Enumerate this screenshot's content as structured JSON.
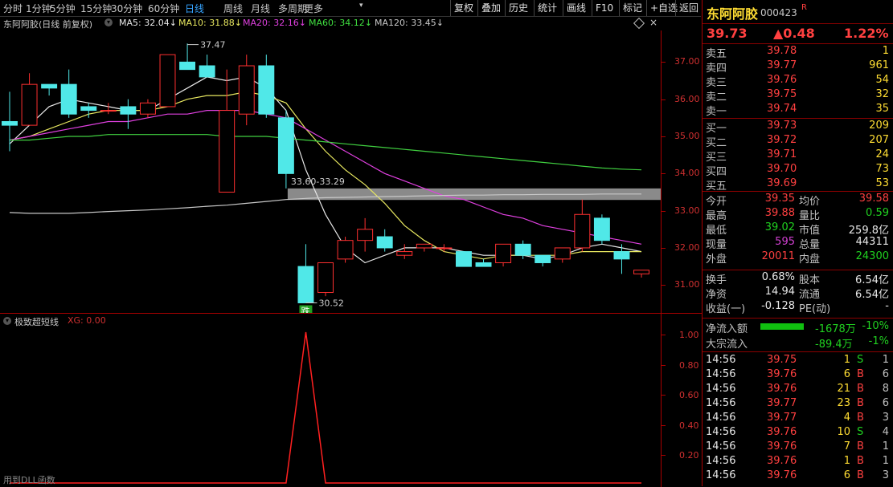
{
  "periods": {
    "tabs": [
      "分时",
      "1分钟",
      "5分钟",
      "15分钟",
      "30分钟",
      "60分钟",
      "日线",
      "周线",
      "月线",
      "多周期",
      "更多"
    ],
    "active": "日线"
  },
  "toolbar": [
    "复权",
    "叠加",
    "历史",
    "统计",
    "画线",
    "F10",
    "标记",
    "+自选",
    "返回"
  ],
  "stock": {
    "name": "东阿阿胶",
    "code": "000423",
    "flag": "R",
    "price": "39.73",
    "change": "▲0.48",
    "pct": "1.22%"
  },
  "chart_header": {
    "title": "东阿阿胶(日线 前复权)",
    "ma": [
      {
        "label": "MA5: 32.04",
        "arrow": "↓",
        "color": "#e8e8e8"
      },
      {
        "label": "MA10: 31.88",
        "arrow": "↓",
        "color": "#e8e860"
      },
      {
        "label": "MA20: 32.16",
        "arrow": "↓",
        "color": "#e040e0"
      },
      {
        "label": "MA60: 34.12",
        "arrow": "↓",
        "color": "#40e040"
      },
      {
        "label": "MA120: 33.45",
        "arrow": "↓",
        "color": "#c8c8c8"
      }
    ]
  },
  "price_axis": {
    "labels": [
      "37.00",
      "36.00",
      "35.00",
      "34.00",
      "33.00",
      "32.00",
      "31.00"
    ],
    "values": [
      37,
      36,
      35,
      34,
      33,
      32,
      31
    ],
    "min": 30.25,
    "max": 37.85
  },
  "annotations": {
    "high": "37.47",
    "low": "30.52",
    "band": "33.60-33.29",
    "signal": "跌"
  },
  "candles": [
    [
      35.4,
      36.2,
      34.6,
      35.3
    ],
    [
      35.3,
      36.7,
      35.6,
      36.4
    ],
    [
      36.4,
      36.4,
      36.1,
      36.3
    ],
    [
      36.4,
      36.8,
      35.5,
      35.6
    ],
    [
      35.8,
      35.9,
      35.5,
      35.7
    ],
    [
      35.7,
      35.9,
      35.6,
      35.7
    ],
    [
      35.8,
      36.0,
      35.2,
      35.6
    ],
    [
      35.6,
      36.0,
      35.5,
      35.9
    ],
    [
      35.8,
      37.2,
      35.8,
      37.2
    ],
    [
      37.0,
      37.5,
      36.8,
      36.8
    ],
    [
      36.9,
      37.2,
      36.6,
      36.6
    ],
    [
      33.5,
      36.8,
      33.5,
      35.7
    ],
    [
      35.6,
      37.2,
      35.3,
      36.9
    ],
    [
      36.9,
      37.2,
      35.5,
      35.6
    ],
    [
      35.5,
      35.7,
      33.6,
      34.0
    ],
    [
      31.5,
      32.1,
      30.52,
      30.52
    ],
    [
      30.8,
      31.6,
      30.7,
      31.6
    ],
    [
      31.7,
      32.3,
      31.6,
      32.2
    ],
    [
      32.2,
      32.8,
      31.9,
      32.5
    ],
    [
      32.3,
      32.5,
      31.9,
      32.0
    ],
    [
      31.8,
      32.1,
      31.7,
      31.9
    ],
    [
      32.0,
      32.1,
      31.9,
      32.1
    ],
    [
      32.0,
      32.1,
      31.9,
      32.0
    ],
    [
      31.9,
      31.9,
      31.5,
      31.5
    ],
    [
      31.6,
      31.7,
      31.5,
      31.5
    ],
    [
      31.6,
      32.1,
      31.5,
      32.1
    ],
    [
      32.1,
      32.2,
      31.7,
      31.8
    ],
    [
      31.8,
      31.8,
      31.5,
      31.6
    ],
    [
      31.7,
      32.0,
      31.6,
      32.0
    ],
    [
      32.0,
      33.3,
      31.9,
      32.9
    ],
    [
      32.8,
      32.9,
      32.1,
      32.2
    ],
    [
      31.9,
      32.1,
      31.3,
      31.7
    ],
    [
      31.3,
      31.4,
      31.2,
      31.4
    ]
  ],
  "ma_lines": {
    "ma5": [
      34.8,
      35.3,
      35.8,
      36.0,
      35.9,
      35.8,
      35.7,
      35.7,
      36.0,
      36.3,
      36.6,
      36.5,
      36.6,
      36.3,
      35.7,
      34.1,
      32.9,
      32.0,
      31.6,
      31.8,
      32.0,
      32.0,
      32.0,
      31.9,
      31.8,
      31.8,
      31.8,
      31.7,
      31.8,
      32.0,
      32.1,
      32.0,
      31.9
    ],
    "ma10": [
      34.9,
      35.0,
      35.2,
      35.4,
      35.6,
      35.7,
      35.7,
      35.7,
      35.8,
      36.0,
      36.1,
      36.1,
      36.2,
      36.1,
      35.9,
      35.2,
      34.6,
      34.1,
      33.7,
      33.2,
      32.6,
      32.2,
      31.9,
      31.8,
      31.7,
      31.8,
      31.8,
      31.8,
      31.8,
      31.9,
      31.9,
      31.9,
      31.9
    ],
    "ma20": [
      34.9,
      35.0,
      35.1,
      35.2,
      35.3,
      35.4,
      35.4,
      35.5,
      35.6,
      35.6,
      35.7,
      35.7,
      35.7,
      35.6,
      35.5,
      35.2,
      34.9,
      34.6,
      34.3,
      34.0,
      33.8,
      33.6,
      33.4,
      33.3,
      33.1,
      32.9,
      32.8,
      32.6,
      32.5,
      32.4,
      32.3,
      32.2,
      32.1
    ],
    "ma60": [
      34.9,
      34.9,
      34.95,
      35.0,
      35.0,
      35.05,
      35.05,
      35.05,
      35.05,
      35.05,
      35.05,
      35.0,
      35.0,
      35.0,
      34.95,
      34.9,
      34.85,
      34.8,
      34.75,
      34.7,
      34.65,
      34.6,
      34.55,
      34.5,
      34.45,
      34.4,
      34.35,
      34.3,
      34.25,
      34.2,
      34.15,
      34.12,
      34.1
    ],
    "ma120": [
      32.95,
      32.93,
      32.93,
      32.93,
      32.95,
      32.98,
      33.0,
      33.02,
      33.05,
      33.08,
      33.12,
      33.15,
      33.2,
      33.25,
      33.3,
      33.33,
      33.35,
      33.36,
      33.37,
      33.38,
      33.39,
      33.4,
      33.41,
      33.42,
      33.42,
      33.43,
      33.43,
      33.44,
      33.44,
      33.44,
      33.45,
      33.45,
      33.45
    ]
  },
  "indicator": {
    "name": "极致超短线",
    "xg": "XG: 0.00",
    "footer": "用到DLL函数",
    "axis": [
      "1.00",
      "0.80",
      "0.60",
      "0.40",
      "0.20"
    ],
    "values": [
      0,
      0,
      0,
      0,
      0,
      0,
      0,
      0,
      0,
      0,
      0,
      0,
      0,
      0,
      0,
      1,
      0,
      0,
      0,
      0,
      0,
      0,
      0,
      0,
      0,
      0,
      0,
      0,
      0,
      0,
      0,
      0,
      0
    ]
  },
  "orderbook": {
    "sell": [
      {
        "l": "卖五",
        "p": "39.78",
        "v": "1"
      },
      {
        "l": "卖四",
        "p": "39.77",
        "v": "961"
      },
      {
        "l": "卖三",
        "p": "39.76",
        "v": "54"
      },
      {
        "l": "卖二",
        "p": "39.75",
        "v": "32"
      },
      {
        "l": "卖一",
        "p": "39.74",
        "v": "35"
      }
    ],
    "buy": [
      {
        "l": "买一",
        "p": "39.73",
        "v": "209"
      },
      {
        "l": "买二",
        "p": "39.72",
        "v": "207"
      },
      {
        "l": "买三",
        "p": "39.71",
        "v": "24"
      },
      {
        "l": "买四",
        "p": "39.70",
        "v": "73"
      },
      {
        "l": "买五",
        "p": "39.69",
        "v": "53"
      }
    ]
  },
  "stats": [
    [
      {
        "l": "今开",
        "v": "39.35",
        "c": "red"
      },
      {
        "l": "均价",
        "v": "39.58",
        "c": "red"
      }
    ],
    [
      {
        "l": "最高",
        "v": "39.88",
        "c": "red"
      },
      {
        "l": "量比",
        "v": "0.59",
        "c": "grn"
      }
    ],
    [
      {
        "l": "最低",
        "v": "39.02",
        "c": "grn"
      },
      {
        "l": "市值",
        "v": "259.8亿",
        "c": "wht"
      }
    ],
    [
      {
        "l": "现量",
        "v": "595",
        "c": "pur"
      },
      {
        "l": "总量",
        "v": "44311",
        "c": "wht"
      }
    ],
    [
      {
        "l": "外盘",
        "v": "20011",
        "c": "red"
      },
      {
        "l": "内盘",
        "v": "24300",
        "c": "grn"
      }
    ]
  ],
  "stats2": [
    [
      {
        "l": "换手",
        "v": "0.68%",
        "c": "wht"
      },
      {
        "l": "股本",
        "v": "6.54亿",
        "c": "wht"
      }
    ],
    [
      {
        "l": "净资",
        "v": "14.94",
        "c": "wht"
      },
      {
        "l": "流通",
        "v": "6.54亿",
        "c": "wht"
      }
    ],
    [
      {
        "l": "收益(一)",
        "v": "-0.128",
        "c": "wht"
      },
      {
        "l": "PE(动)",
        "v": "-",
        "c": "wht"
      }
    ]
  ],
  "flow": [
    {
      "l": "净流入额",
      "v": "-1678万",
      "p": "-10%",
      "bar": 0.6
    },
    {
      "l": "大宗流入",
      "v": "-89.4万",
      "p": "-1%",
      "bar": 0
    }
  ],
  "ticks": [
    {
      "t": "14:56",
      "p": "39.75",
      "v": "1",
      "s": "S",
      "n": "1"
    },
    {
      "t": "14:56",
      "p": "39.76",
      "v": "6",
      "s": "B",
      "n": "6"
    },
    {
      "t": "14:56",
      "p": "39.76",
      "v": "21",
      "s": "B",
      "n": "8"
    },
    {
      "t": "14:56",
      "p": "39.77",
      "v": "23",
      "s": "B",
      "n": "6"
    },
    {
      "t": "14:56",
      "p": "39.77",
      "v": "4",
      "s": "B",
      "n": "3"
    },
    {
      "t": "14:56",
      "p": "39.76",
      "v": "10",
      "s": "S",
      "n": "4"
    },
    {
      "t": "14:56",
      "p": "39.76",
      "v": "7",
      "s": "B",
      "n": "1"
    },
    {
      "t": "14:56",
      "p": "39.76",
      "v": "1",
      "s": "B",
      "n": "1"
    },
    {
      "t": "14:56",
      "p": "39.76",
      "v": "6",
      "s": "B",
      "n": "3"
    }
  ]
}
